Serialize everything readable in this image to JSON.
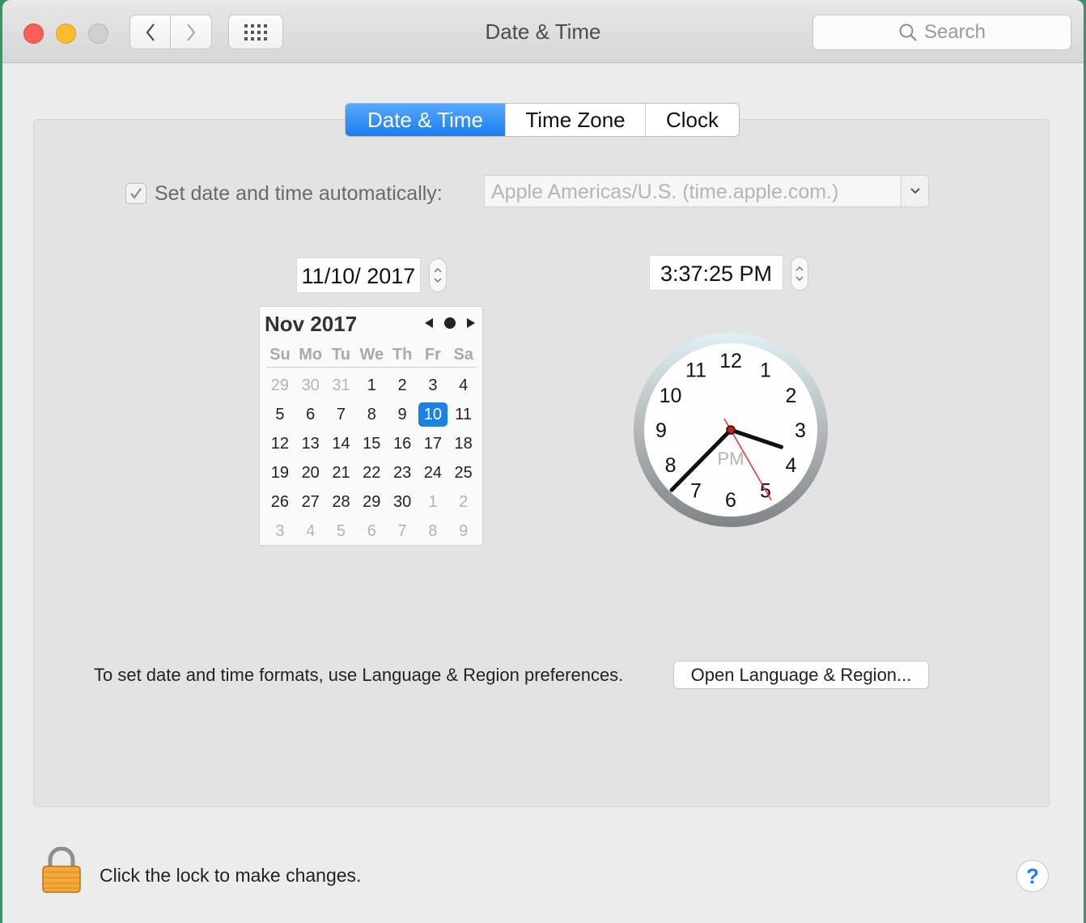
{
  "window": {
    "title": "Date & Time"
  },
  "toolbar": {
    "search_placeholder": "Search"
  },
  "tabs": [
    {
      "label": "Date & Time",
      "active": true
    },
    {
      "label": "Time Zone",
      "active": false
    },
    {
      "label": "Clock",
      "active": false
    }
  ],
  "auto": {
    "checked": true,
    "label": "Set date and time automatically:",
    "server": "Apple Americas/U.S. (time.apple.com.)"
  },
  "date_field": "11/10/ 2017",
  "time_field": "3:37:25 PM",
  "calendar": {
    "month_label": "Nov 2017",
    "weekdays": [
      "Su",
      "Mo",
      "Tu",
      "We",
      "Th",
      "Fr",
      "Sa"
    ],
    "weeks": [
      [
        "29",
        "30",
        "31",
        "1",
        "2",
        "3",
        "4"
      ],
      [
        "5",
        "6",
        "7",
        "8",
        "9",
        "10",
        "11"
      ],
      [
        "12",
        "13",
        "14",
        "15",
        "16",
        "17",
        "18"
      ],
      [
        "19",
        "20",
        "21",
        "22",
        "23",
        "24",
        "25"
      ],
      [
        "26",
        "27",
        "28",
        "29",
        "30",
        "1",
        "2"
      ],
      [
        "3",
        "4",
        "5",
        "6",
        "7",
        "8",
        "9"
      ]
    ],
    "muted_days": [
      [
        0,
        0
      ],
      [
        0,
        1
      ],
      [
        0,
        2
      ],
      [
        4,
        5
      ],
      [
        4,
        6
      ],
      [
        5,
        0
      ],
      [
        5,
        1
      ],
      [
        5,
        2
      ],
      [
        5,
        3
      ],
      [
        5,
        4
      ],
      [
        5,
        5
      ],
      [
        5,
        6
      ]
    ],
    "selected_day": [
      1,
      5
    ]
  },
  "clock": {
    "numerals": [
      "12",
      "1",
      "2",
      "3",
      "4",
      "5",
      "6",
      "7",
      "8",
      "9",
      "10",
      "11"
    ],
    "period": "PM",
    "hours": 3,
    "minutes": 37,
    "seconds": 25
  },
  "formats_text": "To set date and time formats, use Language & Region preferences.",
  "open_button": "Open Language & Region...",
  "lock_text": "Click the lock to make changes.",
  "help_label": "?",
  "colors": {
    "accent": "#1a7cf1",
    "second_hand": "#e8302a"
  }
}
